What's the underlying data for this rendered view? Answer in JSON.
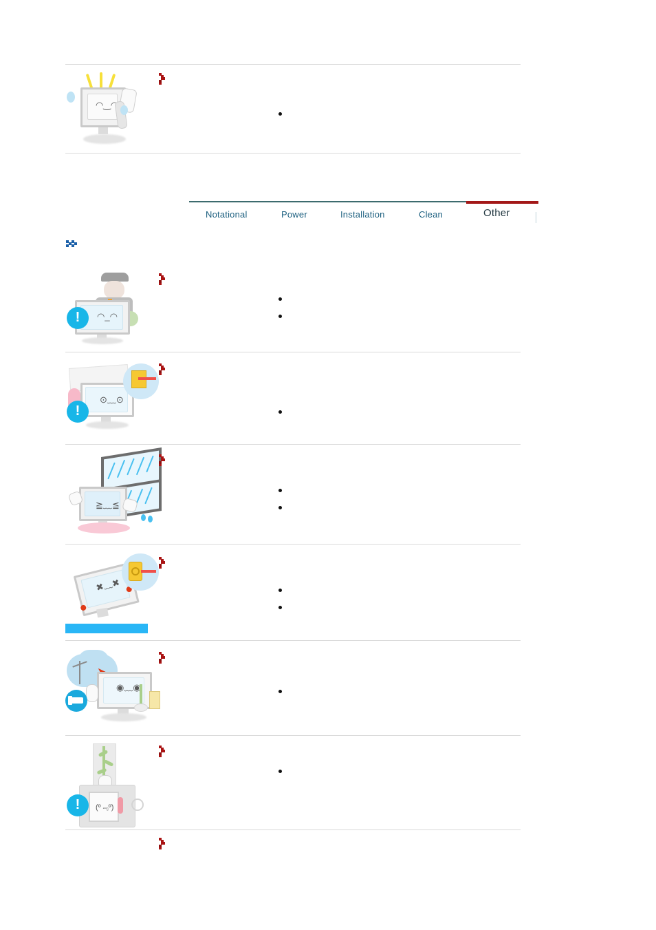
{
  "document": {
    "type": "monitor-user-manual-safety-instructions",
    "active_section": "Other"
  },
  "nav": {
    "name": "safety-instructions-tabs",
    "active_index": 4,
    "tabs": [
      {
        "label": "Notational",
        "active": false
      },
      {
        "label": "Power",
        "active": false
      },
      {
        "label": "Installation",
        "active": false
      },
      {
        "label": "Clean",
        "active": false
      },
      {
        "label": "Other",
        "active": true
      }
    ],
    "accent_active": "#a31818",
    "accent_link": "#1d6080",
    "top_border": "#3d6b6e"
  },
  "top_section": {
    "name": "clean-section-last-item",
    "illustration": "monitor-being-cleaned-with-cloth",
    "marker": "red-chevron",
    "bullets": [
      ""
    ]
  },
  "other_section": {
    "heading_marker": "blue-double-chevron",
    "heading": "",
    "items": [
      {
        "illustration": "technician-servicing-monitor",
        "badge": "exclamation",
        "marker": "red-chevron",
        "bullets": [
          "",
          ""
        ]
      },
      {
        "illustration": "monitor-with-warning-bubble-and-pink-object",
        "badge": "exclamation",
        "marker": "red-chevron",
        "bullets": [
          ""
        ]
      },
      {
        "illustration": "monitor-near-rainy-window",
        "badge": "none",
        "marker": "red-chevron",
        "bullets": [
          "",
          ""
        ]
      },
      {
        "illustration": "tilting-monitor-with-outlet-bubble",
        "badge": "none",
        "marker": "red-chevron",
        "bullets": [
          "",
          ""
        ]
      },
      {
        "illustration": "thunderstorm-unplug-monitor",
        "badge": "unplug",
        "marker": "red-chevron",
        "bullets": [
          ""
        ]
      },
      {
        "illustration": "monitor-in-box-with-plant",
        "badge": "exclamation",
        "marker": "red-chevron",
        "bullets": [
          ""
        ]
      },
      {
        "illustration": "none",
        "badge": "none",
        "marker": "red-chevron",
        "bullets": []
      }
    ]
  },
  "colors": {
    "divider": "#d9d9d9",
    "badge_blue": "#18b6e8",
    "marker_red": "#aa1313",
    "marker_blue": "#1a5fa8"
  }
}
